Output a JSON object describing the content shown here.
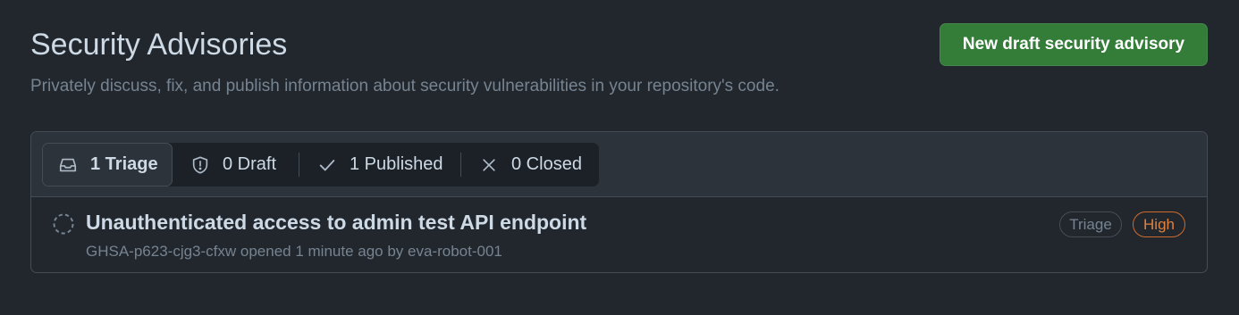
{
  "header": {
    "title": "Security Advisories",
    "subtitle": "Privately discuss, fix, and publish information about security vulnerabilities in your repository's code.",
    "new_button_label": "New draft security advisory"
  },
  "filters": [
    {
      "label": "1 Triage",
      "icon": "inbox-icon",
      "selected": true
    },
    {
      "label": "0 Draft",
      "icon": "shield-alert-icon",
      "selected": false
    },
    {
      "label": "1 Published",
      "icon": "check-icon",
      "selected": false
    },
    {
      "label": "0 Closed",
      "icon": "x-icon",
      "selected": false
    }
  ],
  "advisories": [
    {
      "title": "Unauthenticated access to admin test API endpoint",
      "meta": "GHSA-p623-cjg3-cfxw opened 1 minute ago by eva-robot-001",
      "status_badge": "Triage",
      "severity_badge": "High",
      "icon": "dashed-circle-icon"
    }
  ],
  "colors": {
    "background": "#22272e",
    "primary_button": "#347d39",
    "severity_high": "#e0823d",
    "text_primary": "#cdd9e5",
    "text_muted": "#768390"
  }
}
